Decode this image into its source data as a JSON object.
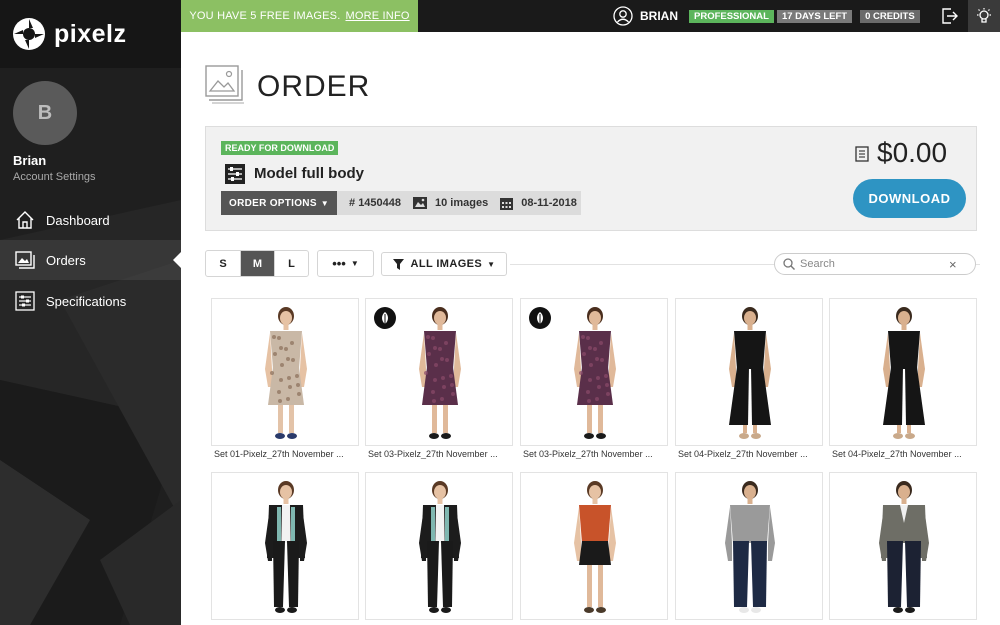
{
  "brand": {
    "name": "pixelz"
  },
  "topbar": {
    "banner_text": "YOU HAVE 5 FREE IMAGES.",
    "banner_link": "MORE INFO",
    "username": "BRIAN",
    "plan": "PROFESSIONAL",
    "days_left": "17 DAYS LEFT",
    "credits": "0 CREDITS",
    "icons": [
      "user-icon",
      "logout-icon",
      "lightbulb-icon"
    ]
  },
  "sidebar": {
    "avatar_initial": "B",
    "user_name": "Brian",
    "account_settings": "Account Settings",
    "items": [
      {
        "label": "Dashboard",
        "icon": "home-icon",
        "active": false
      },
      {
        "label": "Orders",
        "icon": "images-icon",
        "active": true
      },
      {
        "label": "Specifications",
        "icon": "sliders-icon",
        "active": false
      }
    ]
  },
  "page": {
    "title": "ORDER"
  },
  "order": {
    "status": "READY FOR DOWNLOAD",
    "name": "Model full body",
    "options_label": "ORDER OPTIONS",
    "number": "# 1450448",
    "image_count": "10 images",
    "date": "08-11-2018",
    "price": "$0.00",
    "download_label": "DOWNLOAD"
  },
  "toolbar": {
    "sizes": [
      "S",
      "M",
      "L"
    ],
    "active_size": "M",
    "more_label": "•••",
    "filter_label": "ALL IMAGES",
    "search_placeholder": "Search",
    "clear": "×"
  },
  "images": [
    {
      "caption": "Set 01-Pixelz_27th November ...",
      "leaf": false,
      "outfit": "floral-dress"
    },
    {
      "caption": "Set 03-Pixelz_27th November ...",
      "leaf": true,
      "outfit": "purple-dress"
    },
    {
      "caption": "Set 03-Pixelz_27th November ...",
      "leaf": true,
      "outfit": "purple-dress"
    },
    {
      "caption": "Set 04-Pixelz_27th November ...",
      "leaf": false,
      "outfit": "black-jumpsuit"
    },
    {
      "caption": "Set 04-Pixelz_27th November ...",
      "leaf": false,
      "outfit": "black-jumpsuit-back"
    },
    {
      "caption": "",
      "leaf": false,
      "outfit": "jacket-white-top"
    },
    {
      "caption": "",
      "leaf": false,
      "outfit": "jacket-white-top"
    },
    {
      "caption": "",
      "leaf": false,
      "outfit": "orange-top-skirt"
    },
    {
      "caption": "",
      "leaf": false,
      "outfit": "man-grey-shirt"
    },
    {
      "caption": "",
      "leaf": false,
      "outfit": "man-grey-blazer"
    }
  ],
  "colors": {
    "sidebar_bg": "#1f1f1f",
    "banner_green": "#8cc063",
    "badge_green": "#5cb55c",
    "download_blue": "#2e94c3"
  }
}
